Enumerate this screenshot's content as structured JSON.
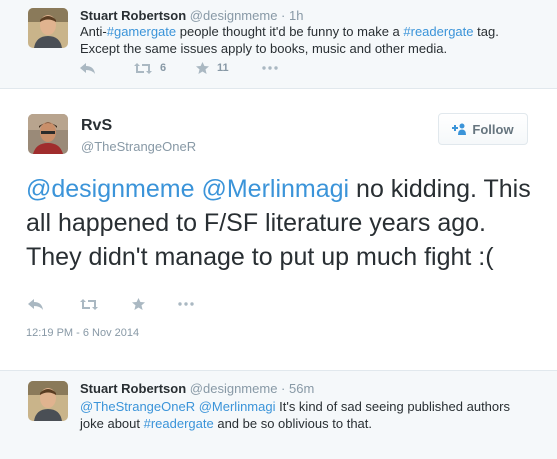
{
  "tweets_top": {
    "fullname": "Stuart Robertson",
    "username": "@designmeme",
    "dot": "·",
    "time": "1h",
    "text_parts": [
      "Anti-",
      "#gamergate",
      " people thought it'd be funny to make a ",
      "#readergate",
      " tag."
    ],
    "text_line2": "Except the same issues apply to books, music and other media.",
    "retweet_count": "6",
    "favorite_count": "11"
  },
  "main_tweet": {
    "fullname": "RvS",
    "username": "@TheStrangeOneR",
    "follow_label": "Follow",
    "text_mention1": "@designmeme",
    "text_mention2": "@Merlinmagi",
    "text_rest": " no kidding. This all happened to F/SF literature years ago. They didn't manage to put up much fight :(",
    "timestamp": "12:19 PM - 6 Nov 2014"
  },
  "tweets_bottom": {
    "fullname": "Stuart Robertson",
    "username": "@designmeme",
    "dot": "·",
    "time": "56m",
    "mention1": "@TheStrangeOneR",
    "mention2": "@Merlinmagi",
    "text_a": " It's kind of sad seeing published authors",
    "text_b1": "joke about ",
    "hashtag": "#readergate",
    "text_b2": " and be so oblivious to that."
  },
  "colors": {
    "link": "#3b94d9",
    "muted": "#8899a6",
    "icon": "#aab8c2",
    "background_alt": "#f5f8fa"
  },
  "icons": [
    "reply-icon",
    "retweet-icon",
    "favorite-icon",
    "more-icon",
    "follow-person-icon"
  ]
}
